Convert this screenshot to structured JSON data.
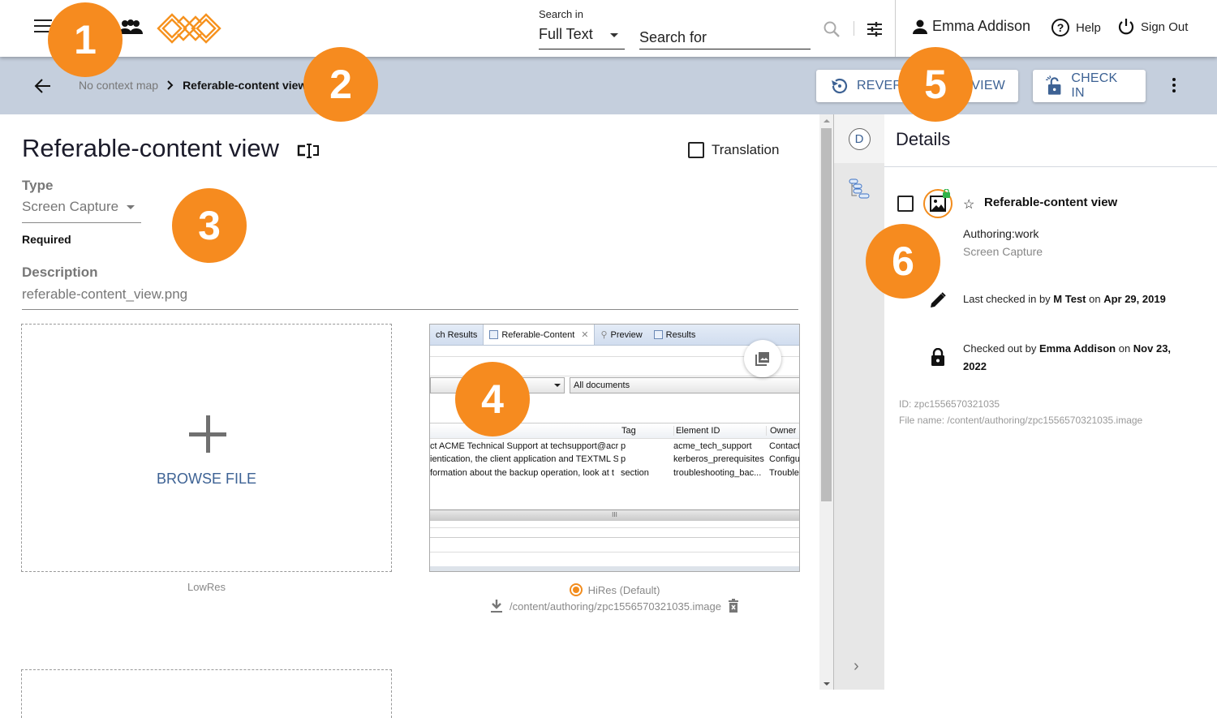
{
  "header": {
    "search_in_label": "Search in",
    "search_in_value": "Full Text",
    "search_placeholder": "Search for",
    "user_name": "Emma Addison",
    "help_label": "Help",
    "signout_label": "Sign Out"
  },
  "breadcrumb": {
    "parent": "No context map",
    "current": "Referable-content view"
  },
  "toolbar": {
    "revert_label": "REVERT",
    "view_label": "VIEW",
    "checkin_label": "CHECK IN"
  },
  "form": {
    "title": "Referable-content view",
    "translation_label": "Translation",
    "translation_checked": false,
    "type_label": "Type",
    "type_value": "Screen Capture",
    "required_label": "Required",
    "description_label": "Description",
    "description_value": "referable-content_view.png"
  },
  "lowres": {
    "browse_label": "BROWSE FILE",
    "caption": "LowRes"
  },
  "hires": {
    "caption": "HiRes (Default)",
    "file_path": "/content/authoring/zpc1556570321035.image",
    "preview": {
      "tabs": [
        "ch Results",
        "Referable-Content",
        "Preview",
        "Results"
      ],
      "filter_value": "All documents",
      "columns": [
        "",
        "Tag",
        "Element ID",
        "Owner"
      ],
      "rows": [
        [
          "ct ACME Technical Support at techsupport@acr",
          "p",
          "acme_tech_support",
          "Contact"
        ],
        [
          "ientication, the client application and TEXTML S",
          "p",
          "kerberos_prerequisites",
          "Configu"
        ],
        [
          "formation about the backup operation, look at t",
          "section",
          "troubleshooting_bac...",
          "Trouble"
        ]
      ],
      "splitter_glyph": "III"
    }
  },
  "rail": {
    "d_label": "D"
  },
  "details": {
    "title": "Details",
    "name": "Referable-content view",
    "location": "Authoring:work",
    "type": "Screen Capture",
    "checked_in_prefix": "Last checked in by ",
    "checked_in_user": "M Test",
    "checked_in_mid": " on ",
    "checked_in_date": "Apr 29, 2019",
    "checked_out_prefix": "Checked out by ",
    "checked_out_user": "Emma Addison",
    "checked_out_mid": " on ",
    "checked_out_date": "Nov 23, 2022",
    "id_line": "ID: zpc1556570321035",
    "file_line": "File name: /content/authoring/zpc1556570321035.image"
  },
  "callouts": [
    "1",
    "2",
    "3",
    "4",
    "5",
    "6"
  ],
  "colors": {
    "accent_orange": "#f68b1f",
    "toolbar_bg": "#c5cfdd",
    "button_text": "#3d6294",
    "lock_green": "#2fb34a"
  }
}
